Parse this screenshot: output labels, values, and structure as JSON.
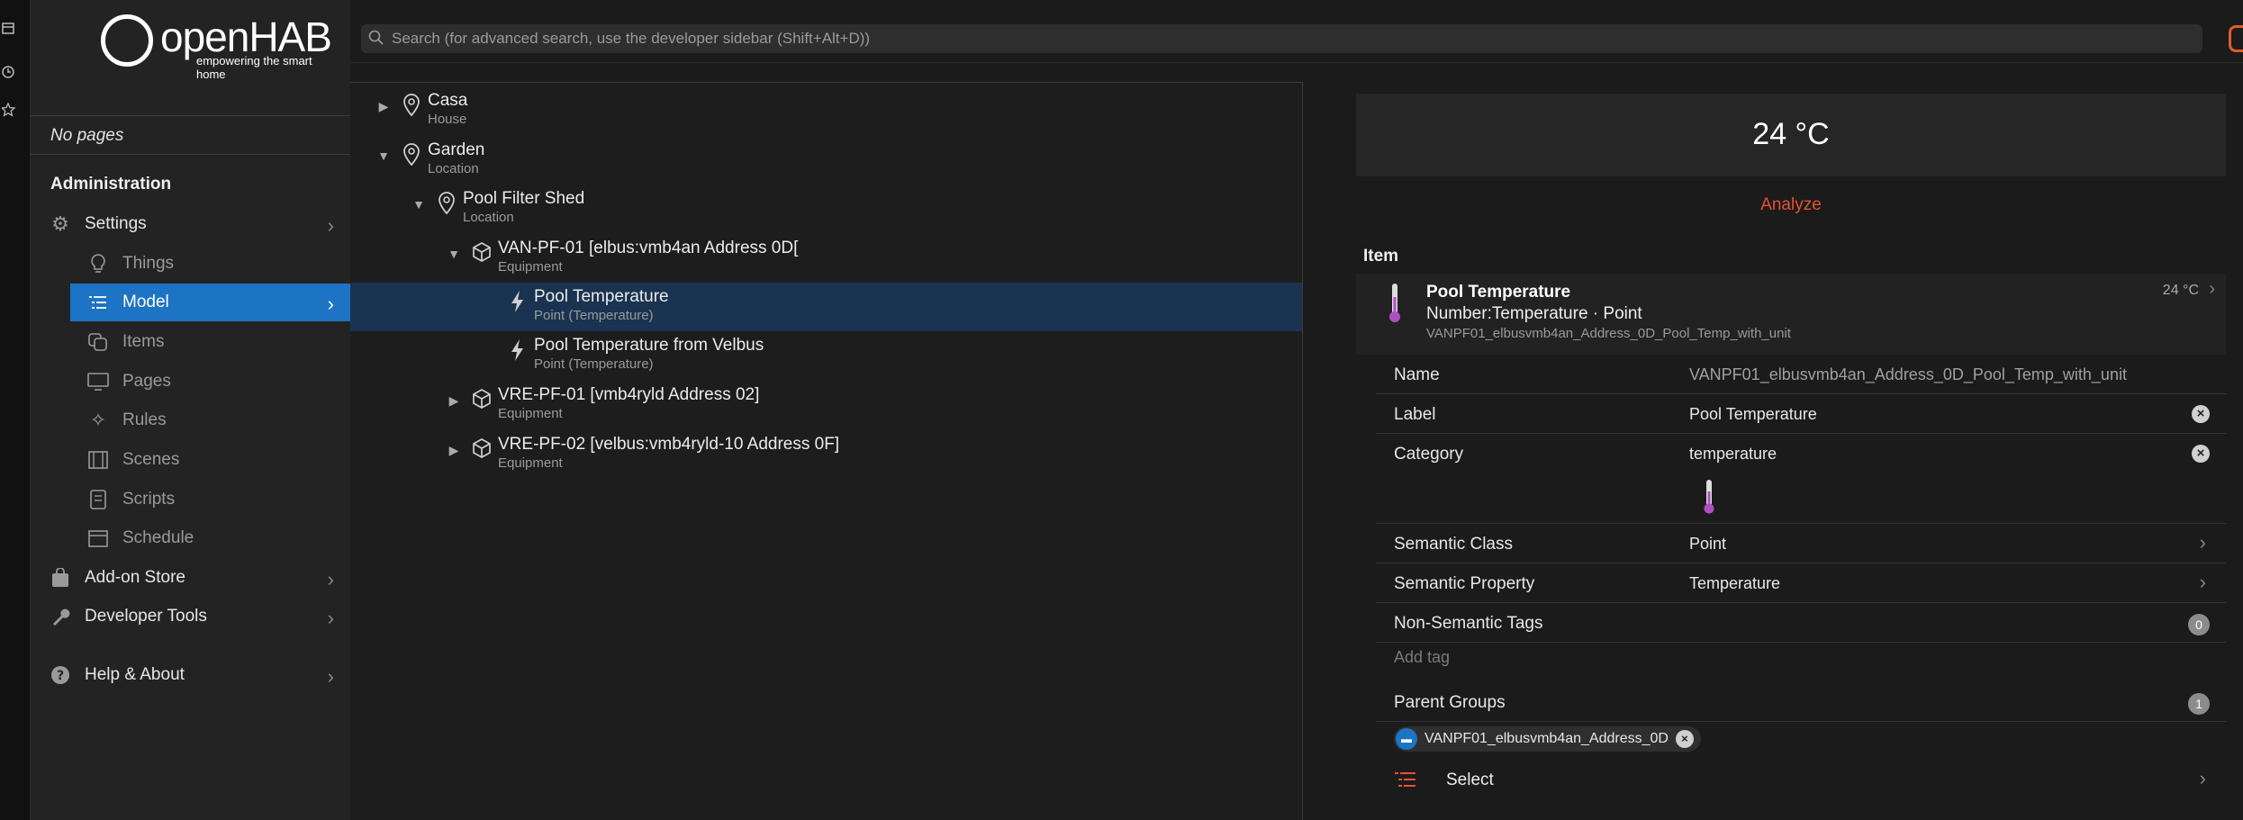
{
  "app": {
    "logo_text": "openHAB",
    "logo_tagline": "empowering the smart home"
  },
  "colors": {
    "accent": "#1d74c4",
    "link": "#e25430",
    "selected_row": "#1a3350"
  },
  "sidebar": {
    "no_pages": "No pages",
    "admin_title": "Administration",
    "items": [
      {
        "label": "Settings",
        "icon": "gear-icon"
      },
      {
        "label": "Things",
        "icon": "lightbulb-icon"
      },
      {
        "label": "Model",
        "icon": "list-tree-icon"
      },
      {
        "label": "Items",
        "icon": "squares-icon"
      },
      {
        "label": "Pages",
        "icon": "monitor-icon"
      },
      {
        "label": "Rules",
        "icon": "wand-icon"
      },
      {
        "label": "Scenes",
        "icon": "film-icon"
      },
      {
        "label": "Scripts",
        "icon": "script-icon"
      },
      {
        "label": "Schedule",
        "icon": "calendar-icon"
      },
      {
        "label": "Add-on Store",
        "icon": "bag-icon"
      },
      {
        "label": "Developer Tools",
        "icon": "wrench-icon"
      },
      {
        "label": "Help & About",
        "icon": "question-icon"
      }
    ]
  },
  "search": {
    "placeholder": "Search (for advanced search, use the developer sidebar (Shift+Alt+D))"
  },
  "tree": {
    "nodes": [
      {
        "label": "Casa",
        "sub": "House"
      },
      {
        "label": "Garden",
        "sub": "Location"
      },
      {
        "label": "Pool Filter Shed",
        "sub": "Location"
      },
      {
        "label": "VAN-PF-01 [elbus:vmb4an Address 0D[",
        "sub": "Equipment"
      },
      {
        "label": "Pool Temperature",
        "sub": "Point (Temperature)"
      },
      {
        "label": "Pool Temperature from Velbus",
        "sub": "Point (Temperature)"
      },
      {
        "label": "VRE-PF-01 [vmb4ryld Address 02]",
        "sub": "Equipment"
      },
      {
        "label": "VRE-PF-02 [velbus:vmb4ryld-10 Address 0F]",
        "sub": "Equipment"
      }
    ]
  },
  "detail": {
    "state": "24 °C",
    "analyze": "Analyze",
    "item_heading": "Item",
    "item_card": {
      "name": "Pool Temperature",
      "type": "Number:Temperature · Point",
      "id": "VANPF01_elbusvmb4an_Address_0D_Pool_Temp_with_unit",
      "state": "24 °C"
    },
    "rows": {
      "name_label": "Name",
      "name_value": "VANPF01_elbusvmb4an_Address_0D_Pool_Temp_with_unit",
      "label_label": "Label",
      "label_value": "Pool Temperature",
      "category_label": "Category",
      "category_value": "temperature",
      "semantic_class_label": "Semantic Class",
      "semantic_class_value": "Point",
      "semantic_property_label": "Semantic Property",
      "semantic_property_value": "Temperature",
      "non_semantic_tags_label": "Non-Semantic Tags",
      "non_semantic_tags_count": "0",
      "add_tag_placeholder": "Add tag",
      "parent_groups_label": "Parent Groups",
      "parent_groups_count": "1"
    },
    "group_chip": "VANPF01_elbusvmb4an_Address_0D",
    "select_label": "Select"
  }
}
